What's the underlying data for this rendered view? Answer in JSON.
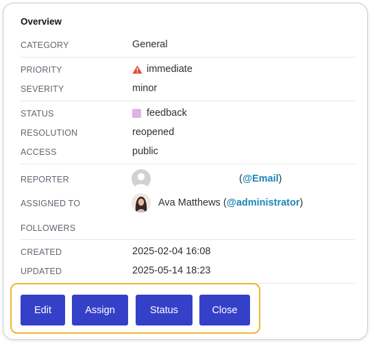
{
  "overview": {
    "title": "Overview",
    "fields": {
      "category": {
        "label": "CATEGORY",
        "value": "General"
      },
      "priority": {
        "label": "PRIORITY",
        "value": "immediate",
        "icon": "warning-icon",
        "icon_color": "#e04b3a"
      },
      "severity": {
        "label": "SEVERITY",
        "value": "minor"
      },
      "status": {
        "label": "STATUS",
        "value": "feedback",
        "swatch_color": "#e0b3e7"
      },
      "resolution": {
        "label": "RESOLUTION",
        "value": "reopened"
      },
      "access": {
        "label": "ACCESS",
        "value": "public"
      },
      "reporter": {
        "label": "REPORTER",
        "name": "",
        "open": "(",
        "handle": "@Email",
        "close": ")",
        "avatar": "default-user-avatar"
      },
      "assigned_to": {
        "label": "ASSIGNED TO",
        "name": "Ava Matthews",
        "open": "(",
        "handle": "@administrator",
        "close": ")",
        "avatar": "user-photo-avatar"
      },
      "followers": {
        "label": "FOLLOWERS",
        "value": ""
      },
      "created": {
        "label": "CREATED",
        "value": "2025-02-04 16:08"
      },
      "updated": {
        "label": "UPDATED",
        "value": "2025-05-14 18:23"
      }
    }
  },
  "actions": {
    "edit": "Edit",
    "assign": "Assign",
    "status": "Status",
    "close": "Close"
  },
  "colors": {
    "button": "#3540c8",
    "highlight_border": "#f0b429",
    "link": "#1c86b8"
  }
}
